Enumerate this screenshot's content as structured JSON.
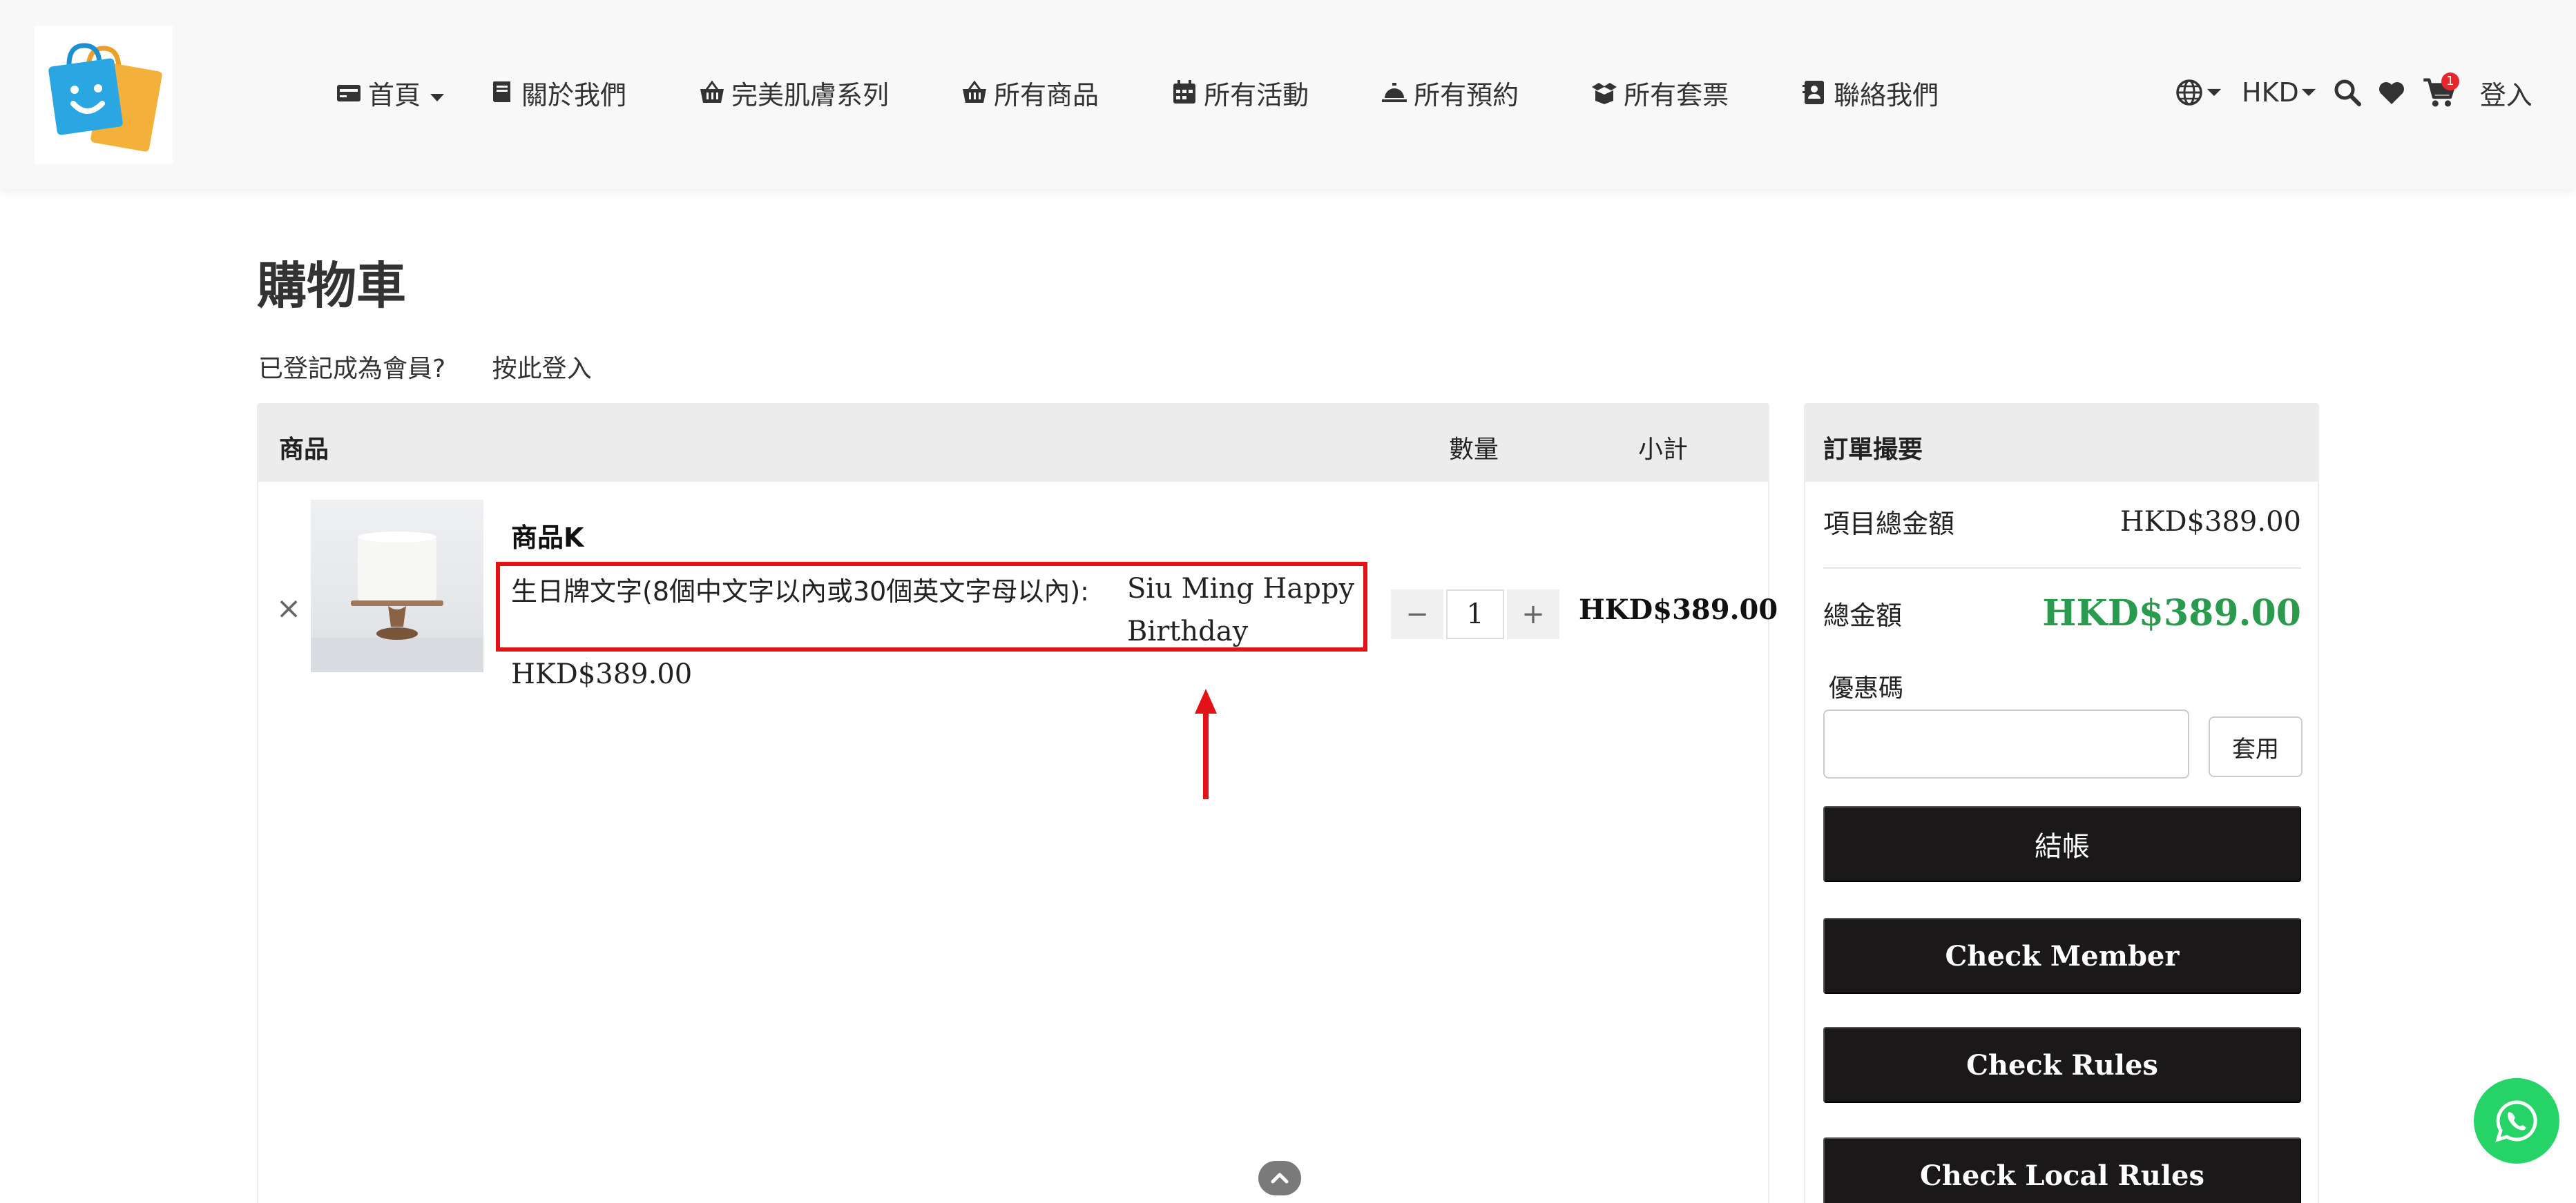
{
  "header": {
    "nav": [
      {
        "label": "首頁",
        "icon": "home-card-icon",
        "has_caret": true
      },
      {
        "label": "關於我們",
        "icon": "book-icon"
      },
      {
        "label": "完美肌膚系列",
        "icon": "basket-icon"
      },
      {
        "label": "所有商品",
        "icon": "basket-icon"
      },
      {
        "label": "所有活動",
        "icon": "calendar-icon"
      },
      {
        "label": "所有預約",
        "icon": "service-bell-icon"
      },
      {
        "label": "所有套票",
        "icon": "box-open-icon"
      },
      {
        "label": "聯絡我們",
        "icon": "address-book-icon"
      }
    ],
    "currency": "HKD",
    "cart_count": "1",
    "login_label": "登入"
  },
  "page": {
    "title": "購物車",
    "member_question": "已登記成為會員?",
    "login_link": "按此登入"
  },
  "cart": {
    "columns": {
      "product": "商品",
      "quantity": "數量",
      "subtotal": "小計"
    },
    "items": [
      {
        "name": "商品K",
        "option_label": "生日牌文字(8個中文字以內或30個英文字母以內):",
        "option_value": "Siu Ming Happy Birthday",
        "unit_price": "HKD$389.00",
        "quantity": "1",
        "line_total": "HKD$389.00",
        "remove_symbol": "×"
      }
    ],
    "qty_minus": "−",
    "qty_plus": "+"
  },
  "summary": {
    "title": "訂單撮要",
    "items_total_label": "項目總金額",
    "items_total_value": "HKD$389.00",
    "grand_total_label": "總金額",
    "grand_total_value": "HKD$389.00",
    "coupon_label": "優惠碼",
    "coupon_placeholder": "",
    "apply_label": "套用",
    "checkout_label": "結帳",
    "check_member_label": "Check Member",
    "check_rules_label": "Check Rules",
    "check_local_rules_label": "Check Local Rules"
  },
  "colors": {
    "accent_green": "#2a9a4e",
    "highlight_red": "#e31217",
    "button_dark": "#1a1818",
    "whatsapp_green": "#25d366"
  }
}
